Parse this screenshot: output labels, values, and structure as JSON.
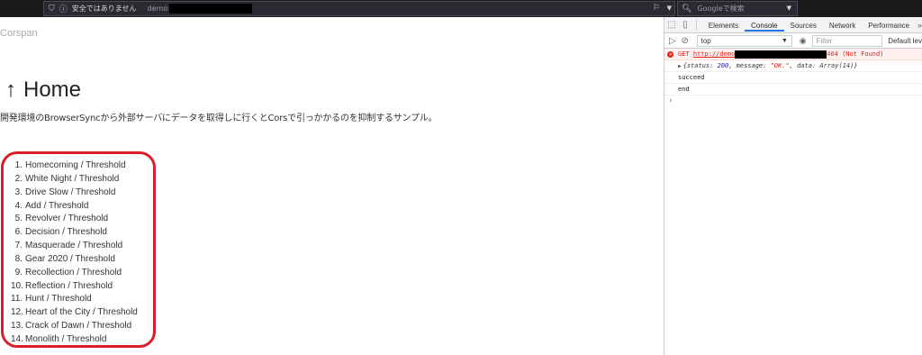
{
  "browser": {
    "security_label": "安全ではありません",
    "url_prefix": "demo",
    "search_placeholder": "Googleで検索"
  },
  "page": {
    "brand": "Corspan",
    "title": "Home",
    "description": "開発環境のBrowserSyncから外部サーバにデータを取得しに行くとCorsで引っかかるのを抑制するサンプル。",
    "tracks": [
      {
        "num": "1.",
        "label": "Homecoming / Threshold"
      },
      {
        "num": "2.",
        "label": "White Night / Threshold"
      },
      {
        "num": "3.",
        "label": "Drive Slow / Threshold"
      },
      {
        "num": "4.",
        "label": "Add / Threshold"
      },
      {
        "num": "5.",
        "label": "Revolver / Threshold"
      },
      {
        "num": "6.",
        "label": "Decision / Threshold"
      },
      {
        "num": "7.",
        "label": "Masquerade / Threshold"
      },
      {
        "num": "8.",
        "label": "Gear 2020 / Threshold"
      },
      {
        "num": "9.",
        "label": "Recollection / Threshold"
      },
      {
        "num": "10.",
        "label": "Reflection / Threshold"
      },
      {
        "num": "11.",
        "label": "Hunt / Threshold"
      },
      {
        "num": "12.",
        "label": "Heart of the City / Threshold"
      },
      {
        "num": "13.",
        "label": "Crack of Dawn / Threshold"
      },
      {
        "num": "14.",
        "label": "Monolith / Threshold"
      }
    ]
  },
  "devtools": {
    "tabs": [
      "Elements",
      "Console",
      "Sources",
      "Network",
      "Performance"
    ],
    "active_tab": "Console",
    "more": "»",
    "context": "top",
    "filter_placeholder": "Filter",
    "levels": "Default lev",
    "console": {
      "error_method": "GET",
      "error_url": "http://demo",
      "error_status": "404 (Not Found)",
      "obj_open": "{status: ",
      "obj_status": "200",
      "obj_mid": ", message: ",
      "obj_message": "\"OK.\"",
      "obj_end": ", data: Array(14)}",
      "log1": "succeed",
      "log2": "end",
      "prompt": "›"
    }
  },
  "colors": {
    "highlight_border": "#d91f2a",
    "active_tab_underline": "#1a73e8",
    "error_text": "#e0251b"
  }
}
